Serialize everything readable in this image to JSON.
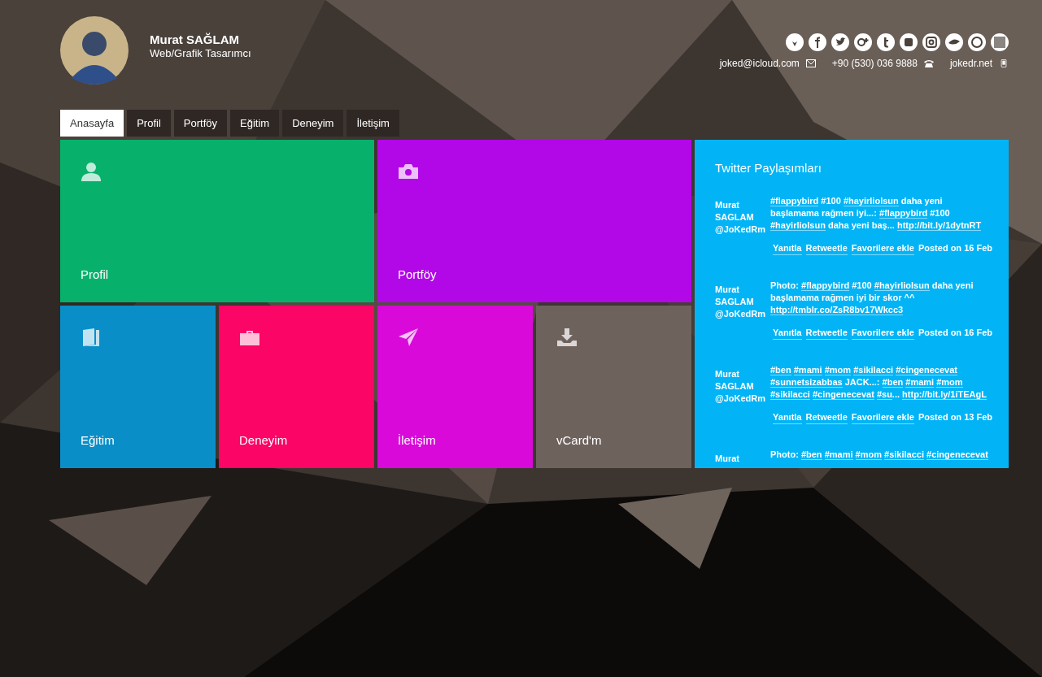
{
  "profile": {
    "name": "Murat SAĞLAM",
    "role": "Web/Grafik Tasarımcı"
  },
  "social": [
    {
      "kind": "antlers"
    },
    {
      "kind": "f"
    },
    {
      "kind": "bird"
    },
    {
      "kind": "gplus"
    },
    {
      "kind": "t"
    },
    {
      "kind": "video"
    },
    {
      "kind": "camera"
    },
    {
      "kind": "eye"
    },
    {
      "kind": "s"
    },
    {
      "kind": "qr"
    }
  ],
  "contacts": [
    {
      "text": "joked@icloud.com",
      "kind": "mail"
    },
    {
      "text": "+90 (530) 036 9888",
      "kind": "phone"
    },
    {
      "text": "jokedr.net",
      "kind": "mobile"
    }
  ],
  "tabs": [
    {
      "label": "Anasayfa",
      "selected": true
    },
    {
      "label": "Profil",
      "selected": false
    },
    {
      "label": "Portföy",
      "selected": false
    },
    {
      "label": "Eğitim",
      "selected": false
    },
    {
      "label": "Deneyim",
      "selected": false
    },
    {
      "label": "İletişim",
      "selected": false
    }
  ],
  "tiles": [
    {
      "label": "Profil",
      "color": "#07b16c"
    },
    {
      "label": "Portföy",
      "color": "#b207e6"
    },
    {
      "label": "Eğitim",
      "color": "#0a8ec7"
    },
    {
      "label": "Deneyim",
      "color": "#fb0566"
    },
    {
      "label": "İletişim",
      "color": "#d909d9"
    },
    {
      "label": "vCard'm",
      "color": "#6e625c"
    }
  ],
  "twitter": {
    "title": "Twitter Paylaşımları",
    "tweets": [
      {
        "author": [
          "Murat",
          "SAGLAM",
          "@JoKedRm"
        ],
        "text": [
          {
            "t": "#flappybird",
            "kind": "link"
          },
          {
            "t": " #100 ",
            "kind": "text"
          },
          {
            "t": "#hayirliolsun",
            "kind": "link"
          },
          {
            "t": " daha yeni başlamama rağmen iyi...: ",
            "kind": "text"
          },
          {
            "t": "#flappybird",
            "kind": "link"
          },
          {
            "t": " #100 ",
            "kind": "text"
          },
          {
            "t": "#hayirliolsun",
            "kind": "link"
          },
          {
            "t": " daha yeni baş... ",
            "kind": "text"
          },
          {
            "t": "http://bit.ly/1dytnRT",
            "kind": "link"
          }
        ],
        "actions": [
          "Yanıtla",
          "Retweetle",
          "Favorilere ekle"
        ],
        "posted": "Posted on 16 Feb"
      },
      {
        "author": [
          "Murat",
          "SAGLAM",
          "@JoKedRm"
        ],
        "text": [
          {
            "t": "Photo: ",
            "kind": "text"
          },
          {
            "t": "#flappybird",
            "kind": "link"
          },
          {
            "t": " #100 ",
            "kind": "text"
          },
          {
            "t": "#hayirliolsun",
            "kind": "link"
          },
          {
            "t": " daha yeni başlamama rağmen iyi bir skor ^^ ",
            "kind": "text"
          },
          {
            "t": "http://tmblr.co/ZsR8bv17Wkcc3",
            "kind": "link"
          }
        ],
        "actions": [
          "Yanıtla",
          "Retweetle",
          "Favorilere ekle"
        ],
        "posted": "Posted on 16 Feb"
      },
      {
        "author": [
          "Murat",
          "SAGLAM",
          "@JoKedRm"
        ],
        "text": [
          {
            "t": "#ben",
            "kind": "link"
          },
          {
            "t": "#mami",
            "kind": "link"
          },
          {
            "t": "#mom",
            "kind": "link"
          },
          {
            "t": "#sikilacci",
            "kind": "link"
          },
          {
            "t": "#cingenecevat",
            "kind": "link"
          },
          {
            "t": "#sunnetsizabbas",
            "kind": "link"
          },
          {
            "t": " JACK...: ",
            "kind": "text"
          },
          {
            "t": "#ben",
            "kind": "link"
          },
          {
            "t": "#mami",
            "kind": "link"
          },
          {
            "t": "#mom",
            "kind": "link"
          },
          {
            "t": "#sikilacci",
            "kind": "link"
          },
          {
            "t": "#cingenecevat",
            "kind": "link"
          },
          {
            "t": "#su",
            "kind": "link"
          },
          {
            "t": "... ",
            "kind": "text"
          },
          {
            "t": "http://bit.ly/1iTEAgL",
            "kind": "link"
          }
        ],
        "actions": [
          "Yanıtla",
          "Retweetle",
          "Favorilere ekle"
        ],
        "posted": "Posted on 13 Feb"
      },
      {
        "author": [
          "Murat"
        ],
        "text": [
          {
            "t": "Photo: ",
            "kind": "text"
          },
          {
            "t": "#ben",
            "kind": "link"
          },
          {
            "t": "#mami",
            "kind": "link"
          },
          {
            "t": "#mom",
            "kind": "link"
          },
          {
            "t": "#sikilacci",
            "kind": "link"
          },
          {
            "t": "#cingenecevat",
            "kind": "link"
          }
        ]
      }
    ]
  }
}
